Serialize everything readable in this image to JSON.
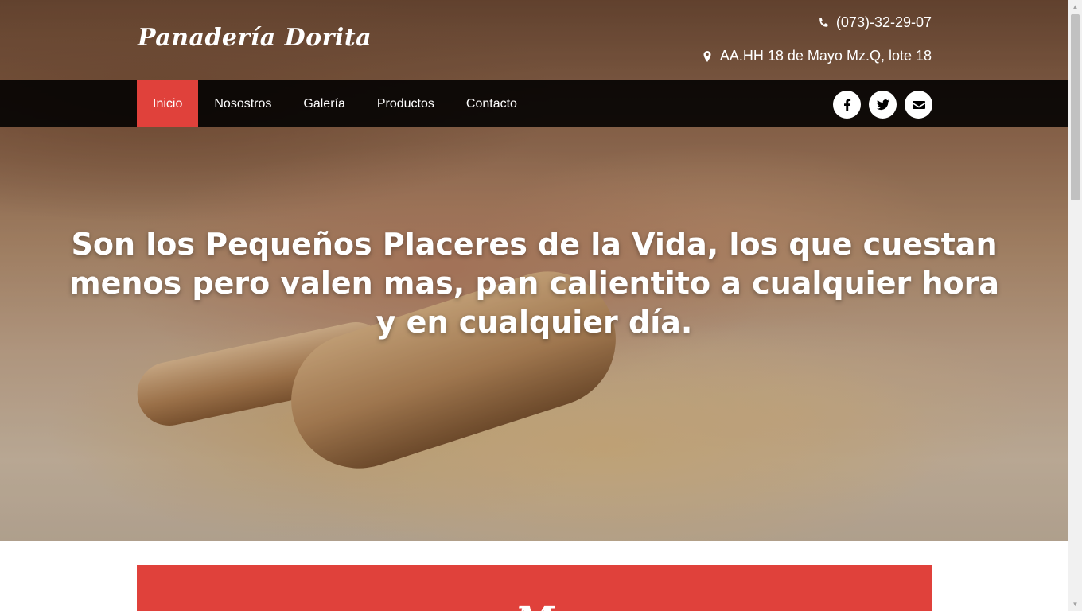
{
  "header": {
    "brand": "Panadería Dorita",
    "phone": "(073)-32-29-07",
    "address": "AA.HH 18 de Mayo Mz.Q, lote 18"
  },
  "nav": {
    "items": [
      {
        "label": "Inicio",
        "active": true
      },
      {
        "label": "Nosostros"
      },
      {
        "label": "Galería"
      },
      {
        "label": "Productos"
      },
      {
        "label": "Contacto"
      }
    ],
    "social": [
      "facebook-icon",
      "twitter-icon",
      "envelope-icon"
    ]
  },
  "hero": {
    "headline": "Son los Pequeños Placeres de la Vida, los que cuestan menos pero valen mas, pan calientito a cualquier hora y en cualquier día."
  },
  "section": {
    "title_partial": "M"
  },
  "colors": {
    "accent": "#e0413b",
    "nav_bg": "#000000"
  }
}
